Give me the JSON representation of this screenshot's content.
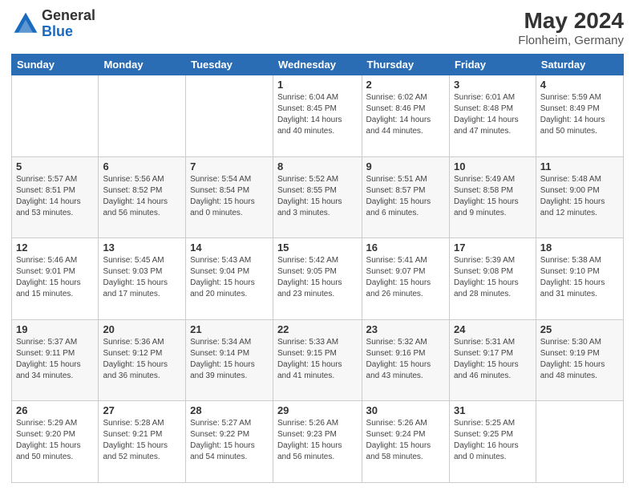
{
  "logo": {
    "general": "General",
    "blue": "Blue"
  },
  "header": {
    "month": "May 2024",
    "location": "Flonheim, Germany"
  },
  "weekdays": [
    "Sunday",
    "Monday",
    "Tuesday",
    "Wednesday",
    "Thursday",
    "Friday",
    "Saturday"
  ],
  "weeks": [
    [
      {
        "day": "",
        "info": ""
      },
      {
        "day": "",
        "info": ""
      },
      {
        "day": "",
        "info": ""
      },
      {
        "day": "1",
        "info": "Sunrise: 6:04 AM\nSunset: 8:45 PM\nDaylight: 14 hours\nand 40 minutes."
      },
      {
        "day": "2",
        "info": "Sunrise: 6:02 AM\nSunset: 8:46 PM\nDaylight: 14 hours\nand 44 minutes."
      },
      {
        "day": "3",
        "info": "Sunrise: 6:01 AM\nSunset: 8:48 PM\nDaylight: 14 hours\nand 47 minutes."
      },
      {
        "day": "4",
        "info": "Sunrise: 5:59 AM\nSunset: 8:49 PM\nDaylight: 14 hours\nand 50 minutes."
      }
    ],
    [
      {
        "day": "5",
        "info": "Sunrise: 5:57 AM\nSunset: 8:51 PM\nDaylight: 14 hours\nand 53 minutes."
      },
      {
        "day": "6",
        "info": "Sunrise: 5:56 AM\nSunset: 8:52 PM\nDaylight: 14 hours\nand 56 minutes."
      },
      {
        "day": "7",
        "info": "Sunrise: 5:54 AM\nSunset: 8:54 PM\nDaylight: 15 hours\nand 0 minutes."
      },
      {
        "day": "8",
        "info": "Sunrise: 5:52 AM\nSunset: 8:55 PM\nDaylight: 15 hours\nand 3 minutes."
      },
      {
        "day": "9",
        "info": "Sunrise: 5:51 AM\nSunset: 8:57 PM\nDaylight: 15 hours\nand 6 minutes."
      },
      {
        "day": "10",
        "info": "Sunrise: 5:49 AM\nSunset: 8:58 PM\nDaylight: 15 hours\nand 9 minutes."
      },
      {
        "day": "11",
        "info": "Sunrise: 5:48 AM\nSunset: 9:00 PM\nDaylight: 15 hours\nand 12 minutes."
      }
    ],
    [
      {
        "day": "12",
        "info": "Sunrise: 5:46 AM\nSunset: 9:01 PM\nDaylight: 15 hours\nand 15 minutes."
      },
      {
        "day": "13",
        "info": "Sunrise: 5:45 AM\nSunset: 9:03 PM\nDaylight: 15 hours\nand 17 minutes."
      },
      {
        "day": "14",
        "info": "Sunrise: 5:43 AM\nSunset: 9:04 PM\nDaylight: 15 hours\nand 20 minutes."
      },
      {
        "day": "15",
        "info": "Sunrise: 5:42 AM\nSunset: 9:05 PM\nDaylight: 15 hours\nand 23 minutes."
      },
      {
        "day": "16",
        "info": "Sunrise: 5:41 AM\nSunset: 9:07 PM\nDaylight: 15 hours\nand 26 minutes."
      },
      {
        "day": "17",
        "info": "Sunrise: 5:39 AM\nSunset: 9:08 PM\nDaylight: 15 hours\nand 28 minutes."
      },
      {
        "day": "18",
        "info": "Sunrise: 5:38 AM\nSunset: 9:10 PM\nDaylight: 15 hours\nand 31 minutes."
      }
    ],
    [
      {
        "day": "19",
        "info": "Sunrise: 5:37 AM\nSunset: 9:11 PM\nDaylight: 15 hours\nand 34 minutes."
      },
      {
        "day": "20",
        "info": "Sunrise: 5:36 AM\nSunset: 9:12 PM\nDaylight: 15 hours\nand 36 minutes."
      },
      {
        "day": "21",
        "info": "Sunrise: 5:34 AM\nSunset: 9:14 PM\nDaylight: 15 hours\nand 39 minutes."
      },
      {
        "day": "22",
        "info": "Sunrise: 5:33 AM\nSunset: 9:15 PM\nDaylight: 15 hours\nand 41 minutes."
      },
      {
        "day": "23",
        "info": "Sunrise: 5:32 AM\nSunset: 9:16 PM\nDaylight: 15 hours\nand 43 minutes."
      },
      {
        "day": "24",
        "info": "Sunrise: 5:31 AM\nSunset: 9:17 PM\nDaylight: 15 hours\nand 46 minutes."
      },
      {
        "day": "25",
        "info": "Sunrise: 5:30 AM\nSunset: 9:19 PM\nDaylight: 15 hours\nand 48 minutes."
      }
    ],
    [
      {
        "day": "26",
        "info": "Sunrise: 5:29 AM\nSunset: 9:20 PM\nDaylight: 15 hours\nand 50 minutes."
      },
      {
        "day": "27",
        "info": "Sunrise: 5:28 AM\nSunset: 9:21 PM\nDaylight: 15 hours\nand 52 minutes."
      },
      {
        "day": "28",
        "info": "Sunrise: 5:27 AM\nSunset: 9:22 PM\nDaylight: 15 hours\nand 54 minutes."
      },
      {
        "day": "29",
        "info": "Sunrise: 5:26 AM\nSunset: 9:23 PM\nDaylight: 15 hours\nand 56 minutes."
      },
      {
        "day": "30",
        "info": "Sunrise: 5:26 AM\nSunset: 9:24 PM\nDaylight: 15 hours\nand 58 minutes."
      },
      {
        "day": "31",
        "info": "Sunrise: 5:25 AM\nSunset: 9:25 PM\nDaylight: 16 hours\nand 0 minutes."
      },
      {
        "day": "",
        "info": ""
      }
    ]
  ]
}
